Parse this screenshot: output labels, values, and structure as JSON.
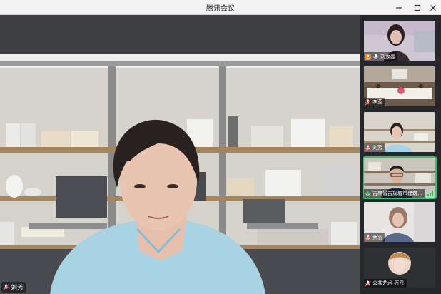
{
  "window": {
    "title": "腾讯会议",
    "controls": [
      "minimize-icon",
      "maximize-icon",
      "close-icon"
    ]
  },
  "main_video": {
    "name": "刘芳"
  },
  "participants": [
    {
      "name": "刘汝晶",
      "mic_icon": "mic-icon",
      "speaking": false
    },
    {
      "name": "李莹",
      "mic_icon": "mic-muted-icon",
      "speaking": false
    },
    {
      "name": "刘芳",
      "mic_icon": "mic-muted-icon",
      "speaking": false
    },
    {
      "name": "吉林省吉规城市建筑…",
      "mic_icon": "mic-icon",
      "speaking": true
    },
    {
      "name": "蔡羽",
      "mic_icon": "mic-muted-icon",
      "speaking": false
    },
    {
      "name": "公共艺术-万丹",
      "mic_icon": "mic-muted-icon",
      "speaking": false
    }
  ],
  "colors": {
    "accent_green": "#2bc46b",
    "host_badge": "#f08a24"
  }
}
